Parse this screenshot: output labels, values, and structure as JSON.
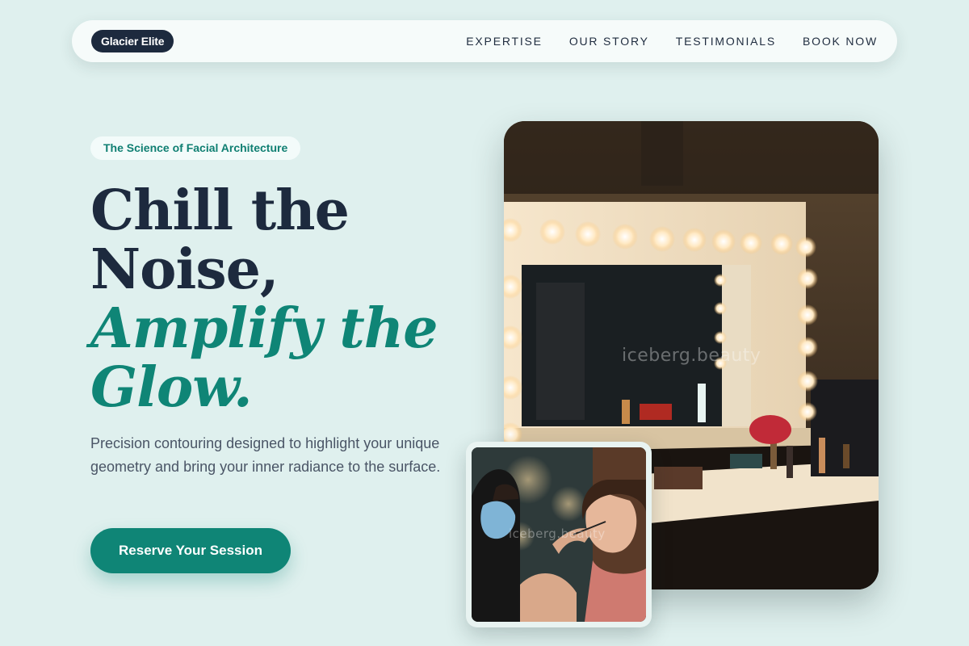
{
  "nav": {
    "logo": "Glacier Elite",
    "links": [
      "EXPERTISE",
      "OUR STORY",
      "TESTIMONIALS",
      "BOOK NOW"
    ]
  },
  "hero": {
    "eyebrow": "The Science of Facial Architecture",
    "headline": {
      "line1": "Chill the",
      "line2": "Noise,",
      "accent_line1": "Amplify the",
      "accent_line2": "Glow."
    },
    "description": "Precision contouring designed to highlight your unique geometry and bring your inner radiance to the surface.",
    "cta_label": "Reserve Your Session"
  },
  "images": {
    "main_watermark": "iceberg.beauty",
    "inset_watermark": "iceberg.beauty"
  },
  "colors": {
    "background": "#dff0ee",
    "accent": "#0f8576",
    "dark": "#1d2a3e"
  }
}
